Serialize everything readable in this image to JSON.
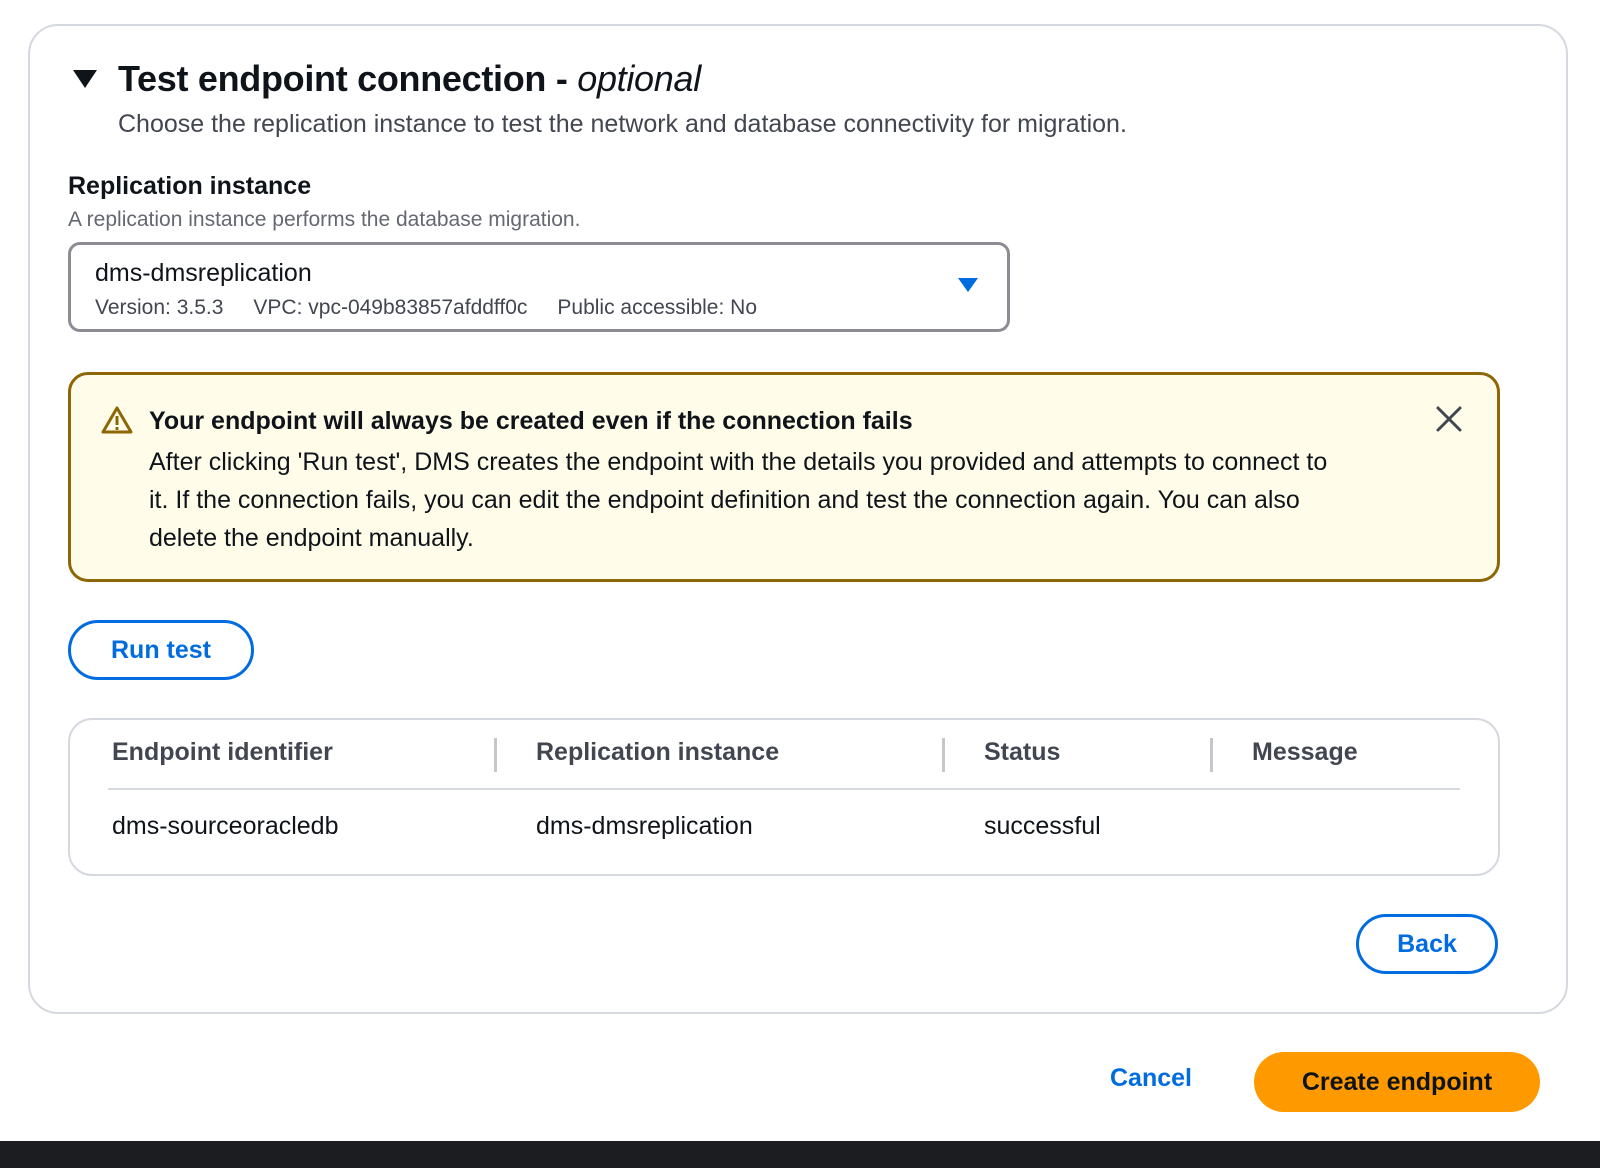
{
  "section": {
    "title": "Test endpoint connection - ",
    "title_optional": "optional",
    "description": "Choose the replication instance to test the network and database connectivity for migration.",
    "expanded": true
  },
  "replication_field": {
    "label": "Replication instance",
    "hint": "A replication instance performs the database migration.",
    "selected_value": "dms-dmsreplication",
    "version": "Version: 3.5.3",
    "vpc": "VPC: vpc-049b83857afddff0c",
    "public_access": "Public accessible: No"
  },
  "alert": {
    "type": "warning",
    "title": "Your endpoint will always be created even if the connection fails",
    "body": "After clicking 'Run test', DMS creates the endpoint with the details you provided and attempts to connect to it. If the connection fails, you can edit the endpoint definition and test the connection again. You can also delete the endpoint manually."
  },
  "actions": {
    "run_test_label": "Run test",
    "back_label": "Back",
    "cancel_label": "Cancel",
    "create_label": "Create endpoint"
  },
  "results_table": {
    "columns": [
      "Endpoint identifier",
      "Replication instance",
      "Status",
      "Message"
    ],
    "rows": [
      {
        "endpoint_identifier": "dms-sourceoracledb",
        "replication_instance": "dms-dmsreplication",
        "status": "successful",
        "message": ""
      }
    ]
  },
  "colors": {
    "link_blue": "#006ce0",
    "primary_orange": "#ff9900",
    "warning_border": "#8d6605",
    "warning_bg": "#fffce9",
    "text_primary": "#0f141a",
    "text_secondary": "#424650"
  },
  "icons": {
    "section_toggle": "caret-down-icon",
    "select_dropdown": "caret-down-icon",
    "alert": "warning-icon",
    "alert_dismiss": "close-icon"
  }
}
